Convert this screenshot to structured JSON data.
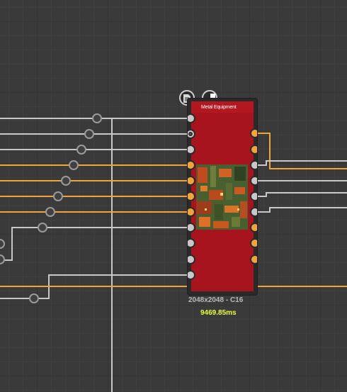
{
  "node": {
    "title": "Metal Equipment",
    "resolution": "2048x2048 - C16",
    "timing": "9469.85ms"
  },
  "toolbar": {
    "doc_icon": "document-icon",
    "checker_icon": "checkerboard-icon"
  },
  "colors": {
    "background": "#3a3a3a",
    "wire_gray": "#c0c0c0",
    "wire_orange": "#f0a43a",
    "node_red": "#a8141d",
    "timing_yellow": "#e6ff3a"
  }
}
